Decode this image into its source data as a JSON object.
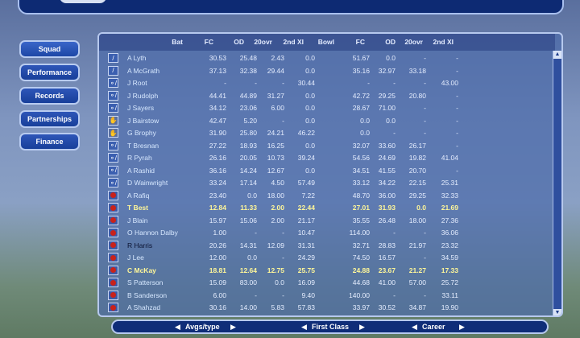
{
  "nav": {
    "items": [
      {
        "label": "Squad"
      },
      {
        "label": "Performance"
      },
      {
        "label": "Records"
      },
      {
        "label": "Partnerships"
      },
      {
        "label": "Finance"
      }
    ]
  },
  "table": {
    "headers": [
      "Bat",
      "FC",
      "OD",
      "20ovr",
      "2nd XI",
      "Bowl",
      "FC",
      "OD",
      "20ovr",
      "2nd XI"
    ],
    "rows": [
      {
        "icon": "bat-icon",
        "name": "A Lyth",
        "bat": [
          "30.53",
          "25.48",
          "2.43",
          "0.0"
        ],
        "bowl": [
          "51.67",
          "0.0",
          "-",
          "-"
        ]
      },
      {
        "icon": "bat-icon",
        "name": "A McGrath",
        "bat": [
          "37.13",
          "32.38",
          "29.44",
          "0.0"
        ],
        "bowl": [
          "35.16",
          "32.97",
          "33.18",
          "-"
        ]
      },
      {
        "icon": "allrounder-icon",
        "name": "J Root",
        "bat": [
          "-",
          "-",
          "-",
          "30.44"
        ],
        "bowl": [
          "-",
          "-",
          "-",
          "43.00"
        ]
      },
      {
        "icon": "allrounder-icon",
        "name": "J Rudolph",
        "bat": [
          "44.41",
          "44.89",
          "31.27",
          "0.0"
        ],
        "bowl": [
          "42.72",
          "29.25",
          "20.80",
          "-"
        ]
      },
      {
        "icon": "allrounder-icon",
        "name": "J Sayers",
        "bat": [
          "34.12",
          "23.06",
          "6.00",
          "0.0"
        ],
        "bowl": [
          "28.67",
          "71.00",
          "-",
          "-"
        ]
      },
      {
        "icon": "keeper-gloves-icon",
        "name": "J Bairstow",
        "bat": [
          "42.47",
          "5.20",
          "-",
          "0.0"
        ],
        "bowl": [
          "0.0",
          "0.0",
          "-",
          "-"
        ]
      },
      {
        "icon": "keeper-gloves-icon",
        "name": "G Brophy",
        "bat": [
          "31.90",
          "25.80",
          "24.21",
          "46.22"
        ],
        "bowl": [
          "0.0",
          "-",
          "-",
          "-"
        ]
      },
      {
        "icon": "allrounder-icon",
        "name": "T Bresnan",
        "bat": [
          "27.22",
          "18.93",
          "16.25",
          "0.0"
        ],
        "bowl": [
          "32.07",
          "33.60",
          "26.17",
          "-"
        ]
      },
      {
        "icon": "allrounder-icon",
        "name": "R Pyrah",
        "bat": [
          "26.16",
          "20.05",
          "10.73",
          "39.24"
        ],
        "bowl": [
          "54.56",
          "24.69",
          "19.82",
          "41.04"
        ]
      },
      {
        "icon": "allrounder-icon",
        "name": "A Rashid",
        "bat": [
          "36.16",
          "14.24",
          "12.67",
          "0.0"
        ],
        "bowl": [
          "34.51",
          "41.55",
          "20.70",
          "-"
        ]
      },
      {
        "icon": "allrounder-icon",
        "name": "D Wainwright",
        "bat": [
          "33.24",
          "17.14",
          "4.50",
          "57.49"
        ],
        "bowl": [
          "33.12",
          "34.22",
          "22.15",
          "25.31"
        ]
      },
      {
        "icon": "ball-icon",
        "name": "A Rafiq",
        "bat": [
          "23.40",
          "0.0",
          "18.00",
          "7.22"
        ],
        "bowl": [
          "48.70",
          "36.00",
          "29.25",
          "32.33"
        ]
      },
      {
        "icon": "ball-icon",
        "name": "T Best",
        "hl": true,
        "bat": [
          "12.84",
          "11.33",
          "2.00",
          "22.44"
        ],
        "bowl": [
          "27.01",
          "31.93",
          "0.0",
          "21.69"
        ]
      },
      {
        "icon": "ball-icon",
        "name": "J Blain",
        "bat": [
          "15.97",
          "15.06",
          "2.00",
          "21.17"
        ],
        "bowl": [
          "35.55",
          "26.48",
          "18.00",
          "27.36"
        ]
      },
      {
        "icon": "ball-icon",
        "name": "O Hannon Dalby",
        "bat": [
          "1.00",
          "-",
          "-",
          "10.47"
        ],
        "bowl": [
          "114.00",
          "-",
          "-",
          "36.06"
        ]
      },
      {
        "icon": "ball-icon",
        "name": "R Harris",
        "dark": true,
        "bat": [
          "20.26",
          "14.31",
          "12.09",
          "31.31"
        ],
        "bowl": [
          "32.71",
          "28.83",
          "21.97",
          "23.32"
        ]
      },
      {
        "icon": "ball-icon",
        "name": "J Lee",
        "bat": [
          "12.00",
          "0.0",
          "-",
          "24.29"
        ],
        "bowl": [
          "74.50",
          "16.57",
          "-",
          "34.59"
        ]
      },
      {
        "icon": "ball-icon",
        "name": "C McKay",
        "hl": true,
        "bat": [
          "18.81",
          "12.64",
          "12.75",
          "25.75"
        ],
        "bowl": [
          "24.88",
          "23.67",
          "21.27",
          "17.33"
        ]
      },
      {
        "icon": "ball-icon",
        "name": "S Patterson",
        "bat": [
          "15.09",
          "83.00",
          "0.0",
          "16.09"
        ],
        "bowl": [
          "44.68",
          "41.00",
          "57.00",
          "25.72"
        ]
      },
      {
        "icon": "ball-icon",
        "name": "B Sanderson",
        "bat": [
          "6.00",
          "-",
          "-",
          "9.40"
        ],
        "bowl": [
          "140.00",
          "-",
          "-",
          "33.11"
        ]
      },
      {
        "icon": "ball-icon",
        "name": "A Shahzad",
        "bat": [
          "30.16",
          "14.00",
          "5.83",
          "57.83"
        ],
        "bowl": [
          "33.97",
          "30.52",
          "34.87",
          "19.90"
        ]
      }
    ]
  },
  "scroll": {
    "up": "▲",
    "down": "▼"
  },
  "bottom": {
    "a": "Avgs/type",
    "b": "First Class",
    "c": "Career",
    "left": "◀",
    "right": "▶"
  }
}
